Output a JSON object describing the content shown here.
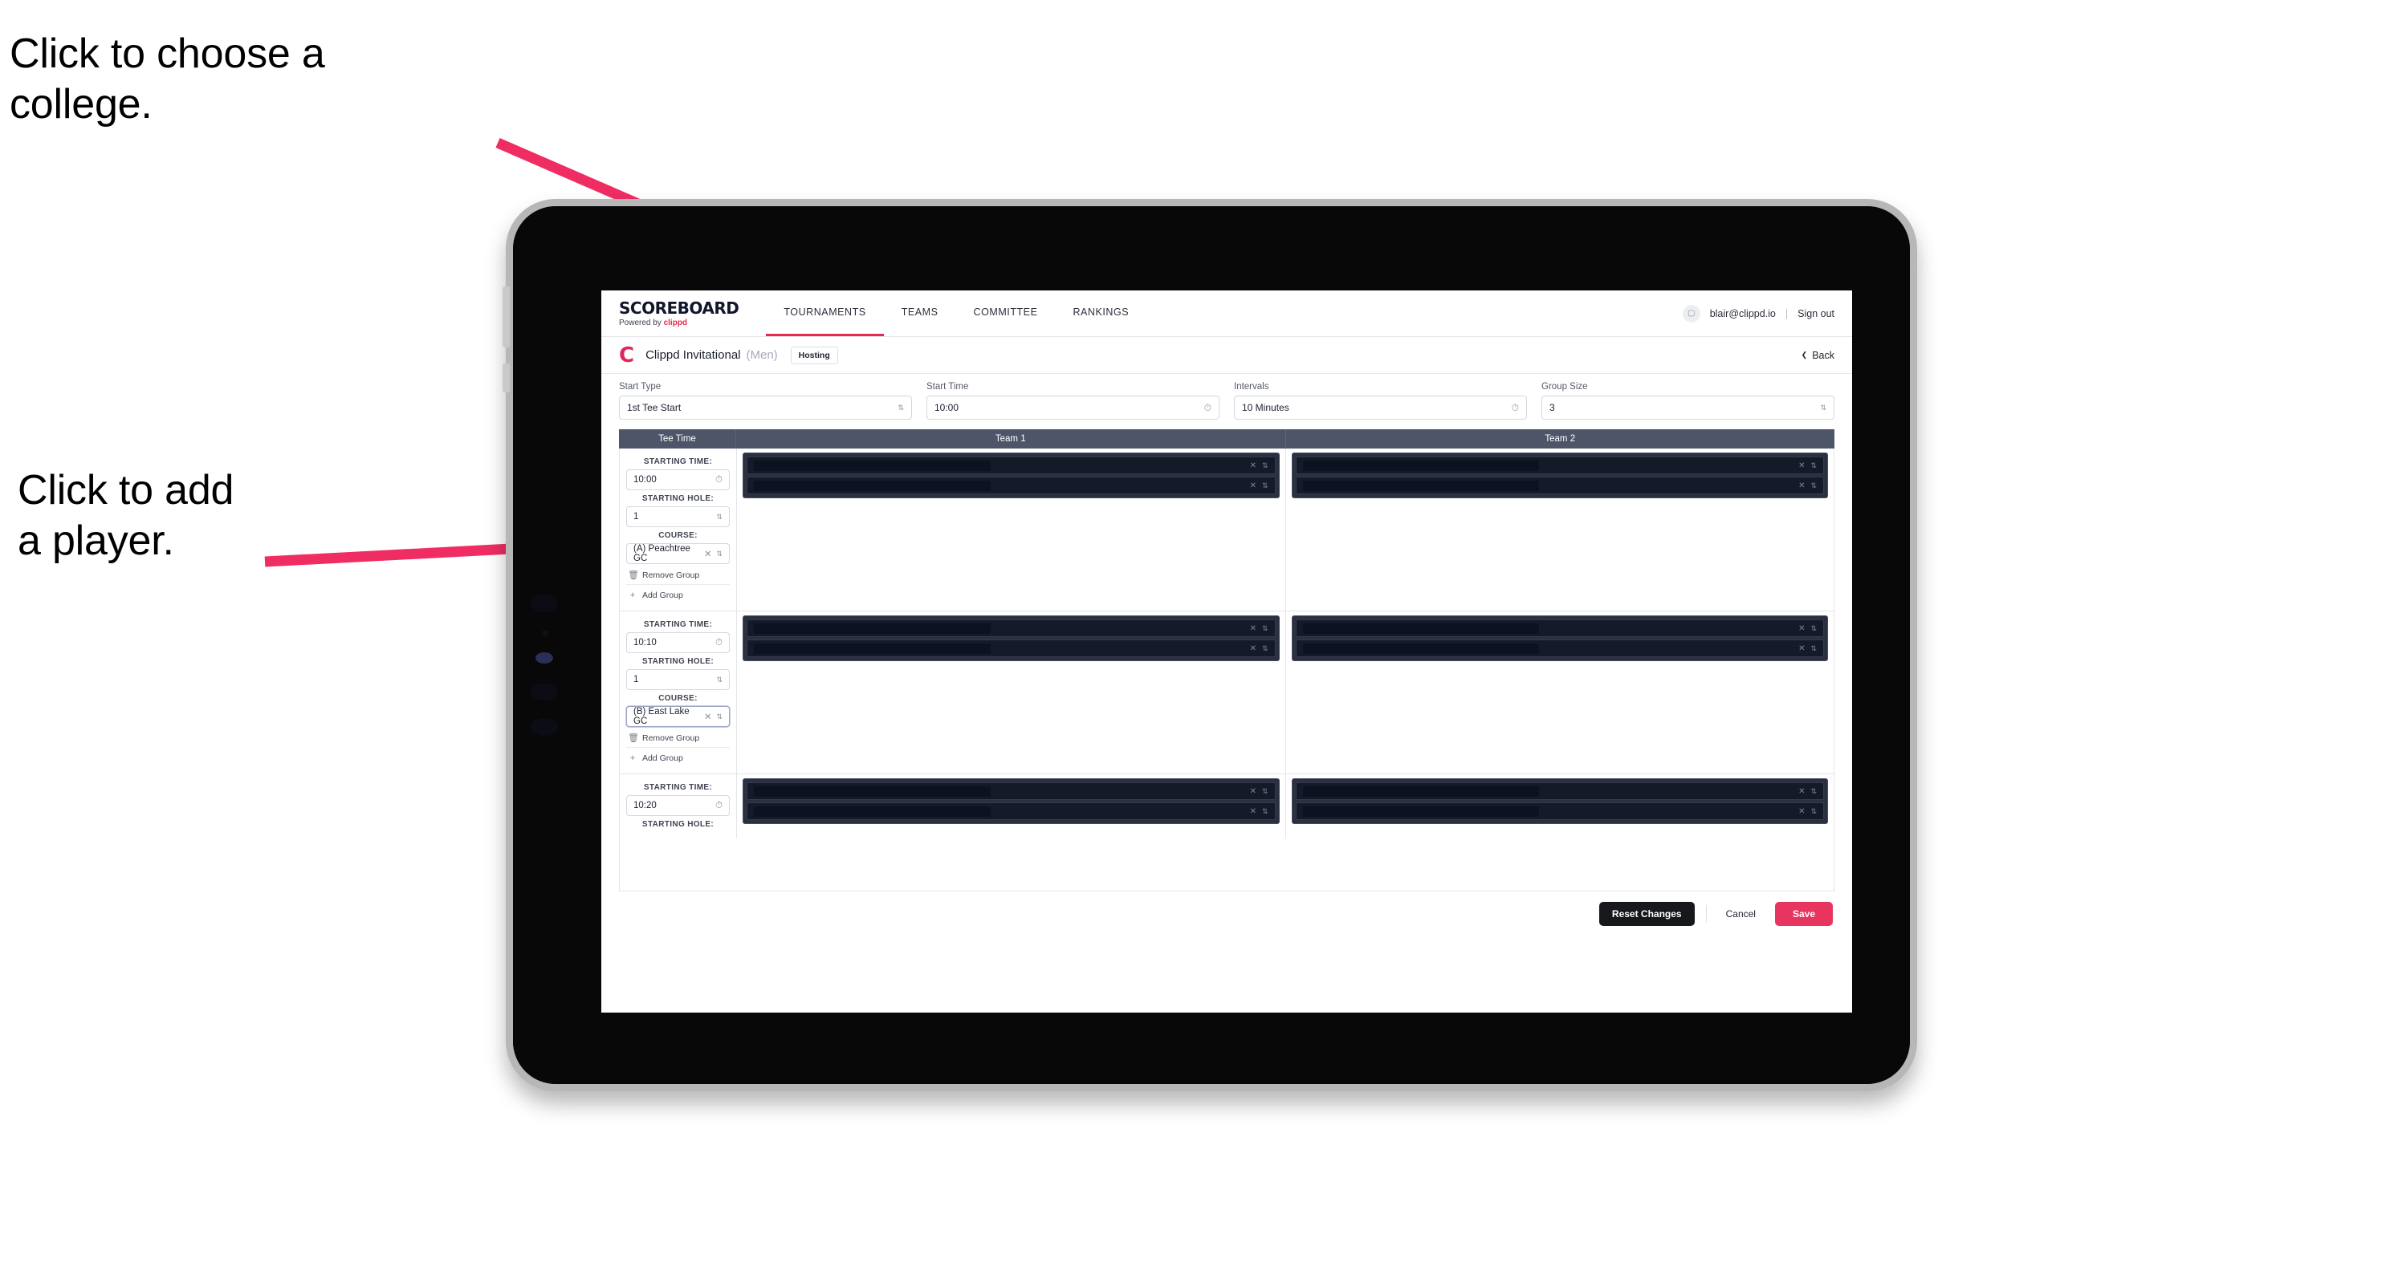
{
  "annotations": {
    "college": "Click to choose a\ncollege.",
    "player": "Click to add\na player."
  },
  "colors": {
    "accent": "#e8284f",
    "save": "#e8355f",
    "header_row": "#4e5569",
    "arrow": "#ef2d63"
  },
  "app": {
    "header": {
      "logo_main": "SCOREBOARD",
      "logo_sub_prefix": "Powered by ",
      "logo_sub_brand": "clippd",
      "nav": [
        {
          "label": "TOURNAMENTS",
          "active": true
        },
        {
          "label": "TEAMS",
          "active": false
        },
        {
          "label": "COMMITTEE",
          "active": false
        },
        {
          "label": "RANKINGS",
          "active": false
        }
      ],
      "user": {
        "avatar_icon": "user-avatar-icon",
        "email": "blair@clippd.io",
        "separator": "|",
        "sign_out": "Sign out"
      }
    },
    "tournament_bar": {
      "logo_letter": "C",
      "name": "Clippd Invitational",
      "gender": "(Men)",
      "badge": "Hosting",
      "back": "Back",
      "back_icon": "chevron-left-icon"
    },
    "form": [
      {
        "label": "Start Type",
        "value": "1st Tee Start",
        "icon": "chevron-updown-icon"
      },
      {
        "label": "Start Time",
        "value": "10:00",
        "icon": "clock-icon"
      },
      {
        "label": "Intervals",
        "value": "10 Minutes",
        "icon": "clock-icon"
      },
      {
        "label": "Group Size",
        "value": "3",
        "icon": "chevron-updown-icon"
      }
    ],
    "table": {
      "columns": [
        "Tee Time",
        "Team 1",
        "Team 2"
      ],
      "labels": {
        "starting_time": "STARTING TIME:",
        "starting_hole": "STARTING HOLE:",
        "course": "COURSE:",
        "remove_group": "Remove Group",
        "add_group": "Add Group",
        "remove_icon": "trash-icon",
        "add_icon": "plus-icon",
        "clear_icon": "close-icon",
        "stepper_icon": "chevron-updown-icon",
        "time_icon": "clock-icon"
      },
      "groups": [
        {
          "starting_time": "10:00",
          "starting_hole": "1",
          "course": "(A) Peachtree GC",
          "course_focused": false,
          "team1_players": [
            "",
            ""
          ],
          "team2_players": [
            "",
            ""
          ]
        },
        {
          "starting_time": "10:10",
          "starting_hole": "1",
          "course": "(B) East Lake GC",
          "course_focused": true,
          "team1_players": [
            "",
            ""
          ],
          "team2_players": [
            "",
            ""
          ]
        },
        {
          "starting_time": "10:20",
          "starting_hole": "",
          "course": "",
          "course_focused": false,
          "team1_players": [
            "",
            ""
          ],
          "team2_players": [
            "",
            ""
          ]
        }
      ]
    },
    "footer": {
      "reset": "Reset Changes",
      "cancel": "Cancel",
      "save": "Save"
    }
  }
}
